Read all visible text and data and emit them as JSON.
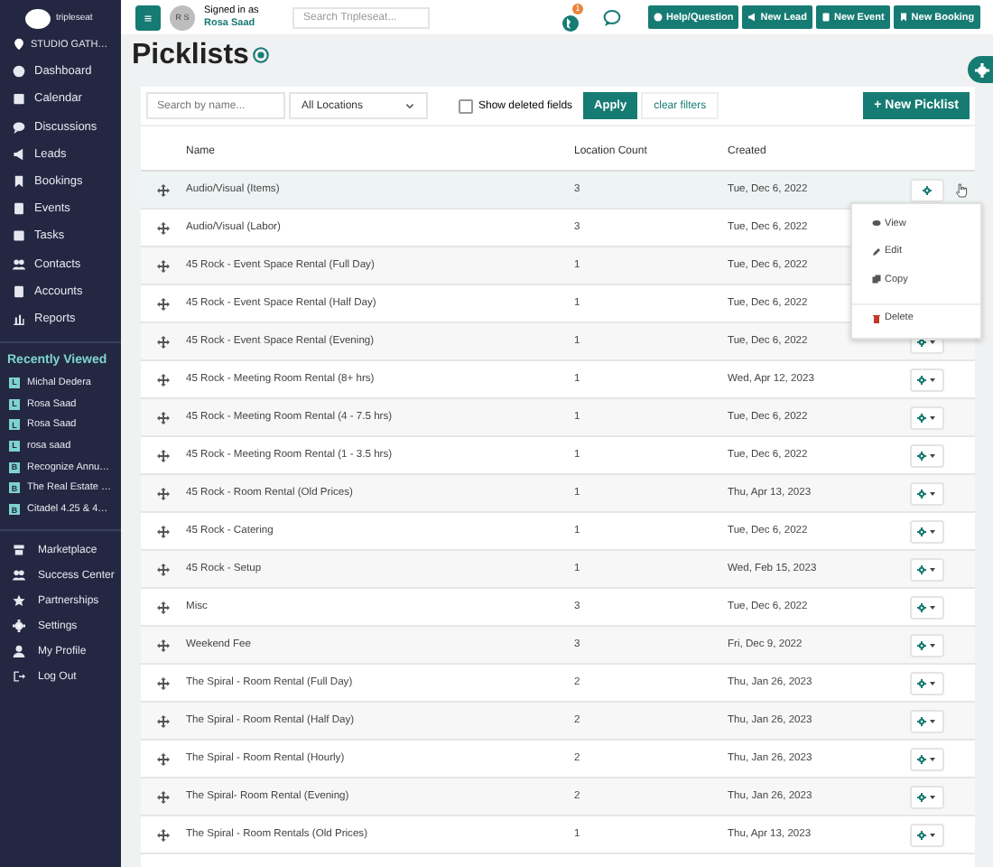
{
  "sidebar": {
    "brand": "tripleseat",
    "location": "STUDIO GATH…",
    "nav": [
      {
        "label": "Dashboard"
      },
      {
        "label": "Calendar"
      },
      {
        "label": "Discussions"
      },
      {
        "label": "Leads"
      },
      {
        "label": "Bookings"
      },
      {
        "label": "Events"
      },
      {
        "label": "Tasks"
      },
      {
        "label": "Contacts"
      },
      {
        "label": "Accounts"
      },
      {
        "label": "Reports"
      }
    ],
    "recent_title": "Recently Viewed",
    "recent": [
      {
        "badge": "L",
        "label": "Michal Dedera"
      },
      {
        "badge": "L",
        "label": "Rosa Saad"
      },
      {
        "badge": "L",
        "label": "Rosa Saad"
      },
      {
        "badge": "L",
        "label": "rosa saad"
      },
      {
        "badge": "B",
        "label": "Recognize Annu…"
      },
      {
        "badge": "B",
        "label": "The Real Estate …"
      },
      {
        "badge": "B",
        "label": "Citadel 4.25 & 4…"
      }
    ],
    "bottom": [
      {
        "label": "Marketplace"
      },
      {
        "label": "Success Center"
      },
      {
        "label": "Partnerships"
      },
      {
        "label": "Settings"
      },
      {
        "label": "My Profile"
      },
      {
        "label": "Log Out"
      }
    ]
  },
  "topbar": {
    "avatar": "R S",
    "signed_in_label": "Signed in as",
    "user": "Rosa Saad",
    "search_placeholder": "Search Tripleseat...",
    "notification_count": "1",
    "buttons": [
      {
        "label": "Help/Question"
      },
      {
        "label": "New Lead"
      },
      {
        "label": "New Event"
      },
      {
        "label": "New Booking"
      }
    ]
  },
  "page": {
    "title": "Picklists"
  },
  "filters": {
    "search_placeholder": "Search by name...",
    "location": "All Locations",
    "show_deleted_label": "Show deleted fields",
    "show_deleted": false,
    "apply": "Apply",
    "clear": "clear filters",
    "new_button": "+ New Picklist"
  },
  "table": {
    "columns": [
      "Name",
      "Location Count",
      "Created"
    ],
    "rows": [
      {
        "name": "Audio/Visual (Items)",
        "count": "3",
        "created": "Tue, Dec 6, 2022",
        "menu_open": true
      },
      {
        "name": "Audio/Visual (Labor)",
        "count": "3",
        "created": "Tue, Dec 6, 2022",
        "menu_open": false
      },
      {
        "name": "45 Rock - Event Space Rental (Full Day)",
        "count": "1",
        "created": "Tue, Dec 6, 2022",
        "menu_open": false
      },
      {
        "name": "45 Rock - Event Space Rental (Half Day)",
        "count": "1",
        "created": "Tue, Dec 6, 2022",
        "menu_open": false
      },
      {
        "name": "45 Rock - Event Space Rental (Evening)",
        "count": "1",
        "created": "Tue, Dec 6, 2022",
        "menu_open": false
      },
      {
        "name": "45 Rock - Meeting Room Rental (8+ hrs)",
        "count": "1",
        "created": "Wed, Apr 12, 2023",
        "menu_open": false
      },
      {
        "name": "45 Rock - Meeting Room Rental (4 - 7.5 hrs)",
        "count": "1",
        "created": "Tue, Dec 6, 2022",
        "menu_open": false
      },
      {
        "name": "45 Rock - Meeting Room Rental (1 - 3.5 hrs)",
        "count": "1",
        "created": "Tue, Dec 6, 2022",
        "menu_open": false
      },
      {
        "name": "45 Rock - Room Rental (Old Prices)",
        "count": "1",
        "created": "Thu, Apr 13, 2023",
        "menu_open": false
      },
      {
        "name": "45 Rock - Catering",
        "count": "1",
        "created": "Tue, Dec 6, 2022",
        "menu_open": false
      },
      {
        "name": "45 Rock - Setup",
        "count": "1",
        "created": "Wed, Feb 15, 2023",
        "menu_open": false
      },
      {
        "name": "Misc",
        "count": "3",
        "created": "Tue, Dec 6, 2022",
        "menu_open": false
      },
      {
        "name": "Weekend Fee",
        "count": "3",
        "created": "Fri, Dec 9, 2022",
        "menu_open": false
      },
      {
        "name": "The Spiral - Room Rental (Full Day)",
        "count": "2",
        "created": "Thu, Jan 26, 2023",
        "menu_open": false
      },
      {
        "name": "The Spiral - Room Rental (Half Day)",
        "count": "2",
        "created": "Thu, Jan 26, 2023",
        "menu_open": false
      },
      {
        "name": "The Spiral - Room Rental (Hourly)",
        "count": "2",
        "created": "Thu, Jan 26, 2023",
        "menu_open": false
      },
      {
        "name": "The Spiral- Room Rental (Evening)",
        "count": "2",
        "created": "Thu, Jan 26, 2023",
        "menu_open": false
      },
      {
        "name": "The Spiral - Room Rentals (Old Prices)",
        "count": "1",
        "created": "Thu, Apr 13, 2023",
        "menu_open": false
      }
    ],
    "action_menu": [
      {
        "label": "View",
        "kind": "view"
      },
      {
        "label": "Edit",
        "kind": "edit"
      },
      {
        "label": "Copy",
        "kind": "copy"
      },
      {
        "label": "Delete",
        "kind": "delete"
      }
    ]
  }
}
